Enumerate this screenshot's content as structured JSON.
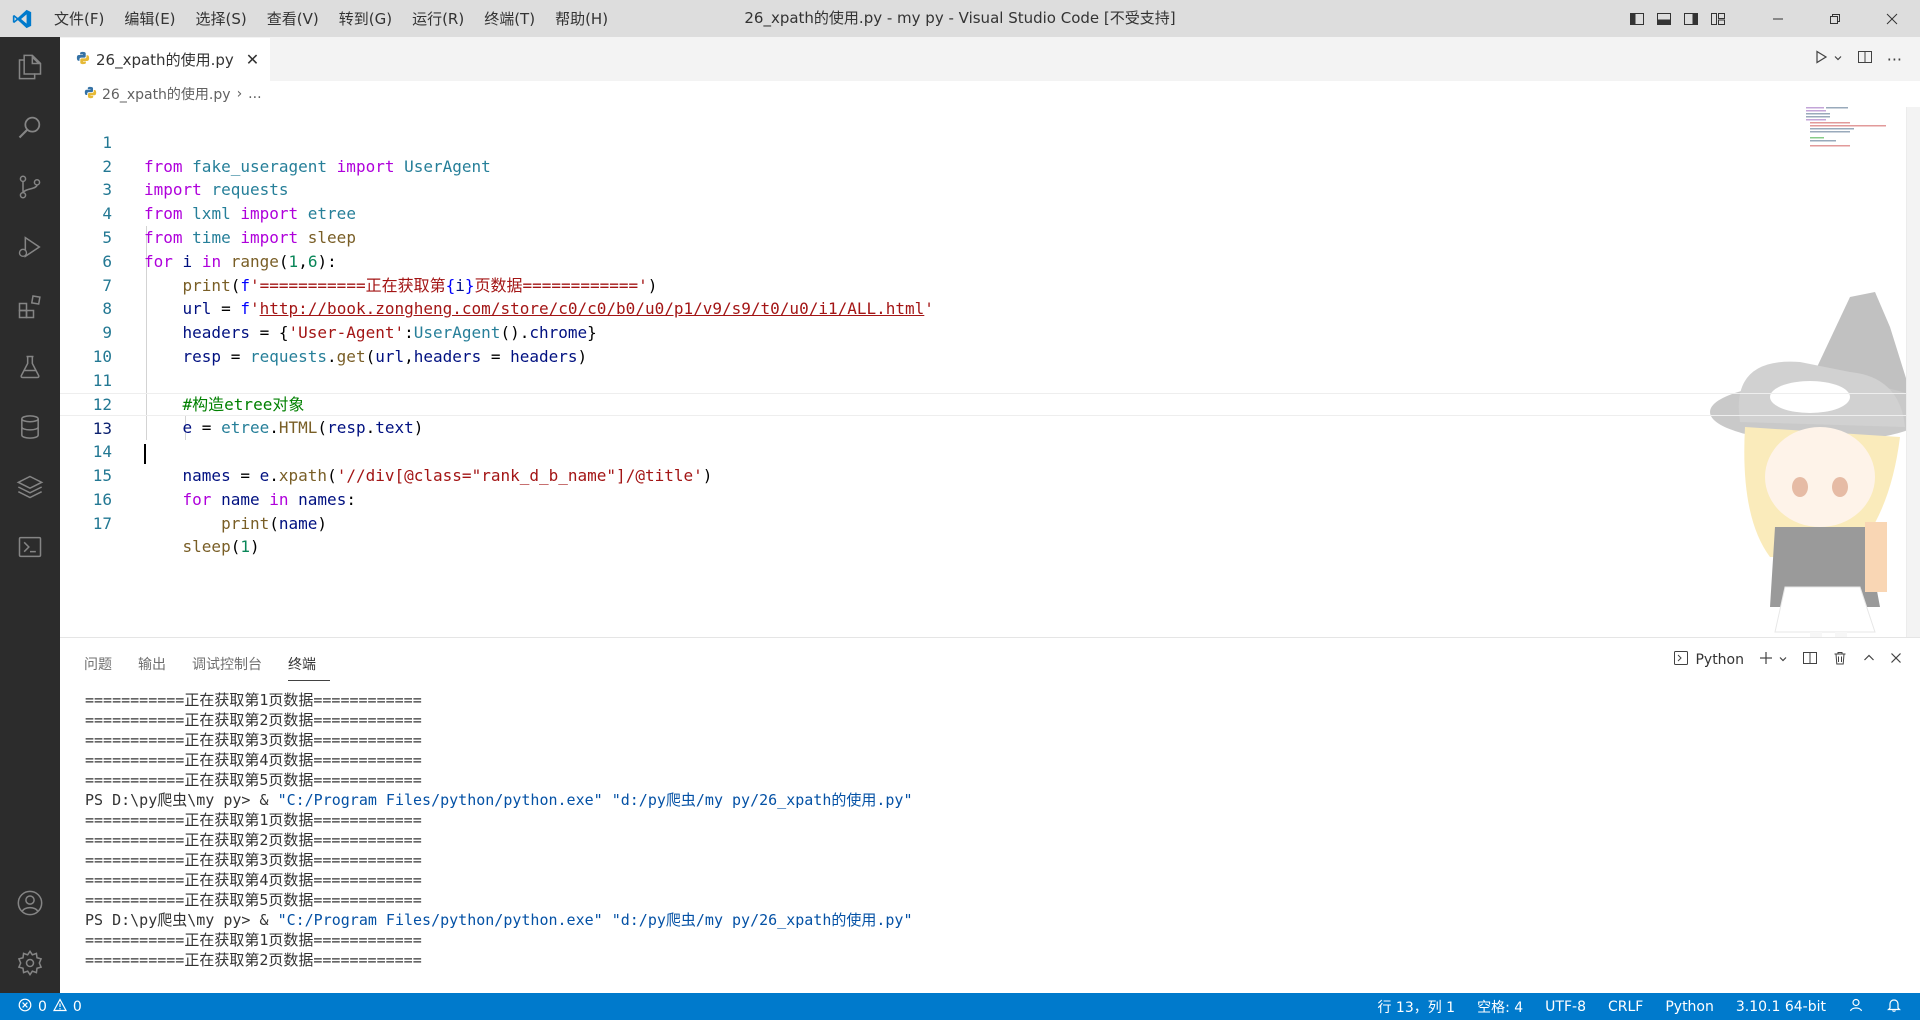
{
  "titlebar": {
    "menu": [
      "文件(F)",
      "编辑(E)",
      "选择(S)",
      "查看(V)",
      "转到(G)",
      "运行(R)",
      "终端(T)",
      "帮助(H)"
    ],
    "title": "26_xpath的使用.py - my py - Visual Studio Code [不受支持]"
  },
  "editor": {
    "tab_label": "26_xpath的使用.py",
    "breadcrumb": {
      "file": "26_xpath的使用.py",
      "more": "..."
    },
    "current_line": 13
  },
  "code": {
    "l1": {
      "n": "1",
      "a": "from",
      "b": "fake_useragent",
      "c": "import",
      "d": "UserAgent"
    },
    "l2": {
      "n": "2",
      "a": "import",
      "b": "requests"
    },
    "l3": {
      "n": "3",
      "a": "from",
      "b": "lxml",
      "c": "import",
      "d": "etree"
    },
    "l4": {
      "n": "4",
      "a": "from",
      "b": "time",
      "c": "import",
      "d": "sleep"
    },
    "l5": {
      "n": "5",
      "a": "for",
      "b": "i",
      "c": "in",
      "d": "range",
      "e": "(",
      "f": "1",
      "g": ",",
      "h": "6",
      "i": "):"
    },
    "l6": {
      "n": "6",
      "a": "print",
      "b": "(",
      "c": "f",
      "d": "'===========正在获取第",
      "e": "{",
      "f": "i",
      "g": "}",
      "h": "页数据============'",
      "i": ")"
    },
    "l7": {
      "n": "7",
      "a": "url",
      "b": " = ",
      "c": "f",
      "d": "'",
      "e": "http://book.zongheng.com/store/c0/c0/b0/u0/p1/v9/s9/t0/u0/i1/ALL.html",
      "f": "'"
    },
    "l8": {
      "n": "8",
      "a": "headers",
      "b": " = {",
      "c": "'User-Agent'",
      "d": ":",
      "e": "UserAgent",
      "f": "().",
      "g": "chrome",
      "h": "}"
    },
    "l9": {
      "n": "9",
      "a": "resp",
      "b": " = ",
      "c": "requests",
      "d": ".",
      "e": "get",
      "f": "(",
      "g": "url",
      "h": ",",
      "i": "headers",
      "j": " = ",
      "k": "headers",
      "l": ")"
    },
    "l10": {
      "n": "10"
    },
    "l11": {
      "n": "11",
      "a": "#构造etree对象"
    },
    "l12": {
      "n": "12",
      "a": "e",
      "b": " = ",
      "c": "etree",
      "d": ".",
      "e": "HTML",
      "f": "(",
      "g": "resp",
      "h": ".",
      "i": "text",
      "j": ")"
    },
    "l13": {
      "n": "13"
    },
    "l14": {
      "n": "14",
      "a": "names",
      "b": " = ",
      "c": "e",
      "d": ".",
      "e": "xpath",
      "f": "(",
      "g": "'//div[@class=\"rank_d_b_name\"]/@title'",
      "h": ")"
    },
    "l15": {
      "n": "15",
      "a": "for",
      "b": "name",
      "c": "in",
      "d": "names",
      "e": ":"
    },
    "l16": {
      "n": "16",
      "a": "print",
      "b": "(",
      "c": "name",
      "d": ")"
    },
    "l17": {
      "n": "17",
      "a": "sleep",
      "b": "(",
      "c": "1",
      "d": ")"
    }
  },
  "panel": {
    "tabs": [
      "问题",
      "输出",
      "调试控制台",
      "终端"
    ],
    "active_tab": "终端",
    "terminal_name": "Python",
    "lines": {
      "t1": "===========正在获取第1页数据============",
      "t2": "===========正在获取第2页数据============",
      "t3": "===========正在获取第3页数据============",
      "t4": "===========正在获取第4页数据============",
      "t5": "===========正在获取第5页数据============",
      "p1": "PS D:\\py爬虫\\my py> & ",
      "p1a": "\"C:/Program Files/python/python.exe\"",
      "p1b": " ",
      "p1c": "\"d:/py爬虫/my py/26_xpath的使用.py\"",
      "t6": "===========正在获取第1页数据============",
      "t7": "===========正在获取第2页数据============",
      "t8": "===========正在获取第3页数据============",
      "t9": "===========正在获取第4页数据============",
      "t10": "===========正在获取第5页数据============",
      "p2": "PS D:\\py爬虫\\my py> & ",
      "p2a": "\"C:/Program Files/python/python.exe\"",
      "p2b": " ",
      "p2c": "\"d:/py爬虫/my py/26_xpath的使用.py\"",
      "t11": "===========正在获取第1页数据============",
      "t12": "===========正在获取第2页数据============"
    }
  },
  "statusbar": {
    "errors": "0",
    "warnings": "0",
    "position": "行 13，列 1",
    "spaces": "空格: 4",
    "encoding": "UTF-8",
    "eol": "CRLF",
    "language": "Python",
    "interpreter": "3.10.1 64-bit"
  },
  "colors": {
    "status_bar": "#007acc",
    "activity_bar": "#2c2c2c",
    "title_bar": "#dddddd"
  }
}
